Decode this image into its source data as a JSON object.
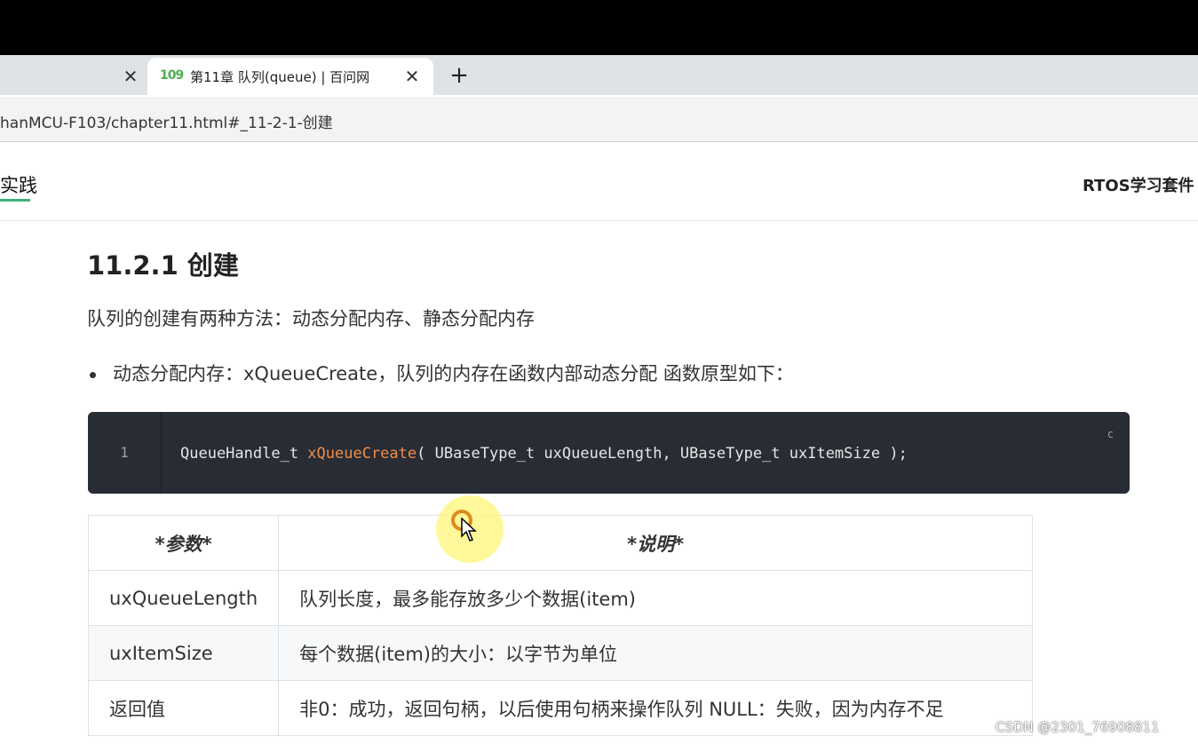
{
  "browser": {
    "inactive_tab_close": "✕",
    "active_tab": {
      "favicon": "109",
      "title": "第11章 队列(queue) | 百问网",
      "close": "✕"
    },
    "new_tab": "+",
    "url": "hanMCU-F103/chapter11.html#_11-2-1-创建"
  },
  "navbar": {
    "left_item": "实践",
    "right_item": "RTOS学习套件",
    "accent_color": "#3eaf7c"
  },
  "content": {
    "heading": "11.2.1 创建",
    "intro": "队列的创建有两种方法：动态分配内存、静态分配内存",
    "bullet": "动态分配内存：xQueueCreate，队列的内存在函数内部动态分配 函数原型如下："
  },
  "code": {
    "line_number": "1",
    "before_fn": "QueueHandle_t ",
    "function": "xQueueCreate",
    "after_fn": "( UBaseType_t uxQueueLength, UBaseType_t uxItemSize );",
    "language": "c"
  },
  "table": {
    "headers": [
      "*参数*",
      "*说明*"
    ],
    "rows": [
      [
        "uxQueueLength",
        "队列长度，最多能存放多少个数据(item)"
      ],
      [
        "uxItemSize",
        "每个数据(item)的大小：以字节为单位"
      ],
      [
        "返回值",
        "非0：成功，返回句柄，以后使用句柄来操作队列 NULL：失败，因为内存不足"
      ]
    ]
  },
  "watermark": "CSDN @2301_76908811"
}
